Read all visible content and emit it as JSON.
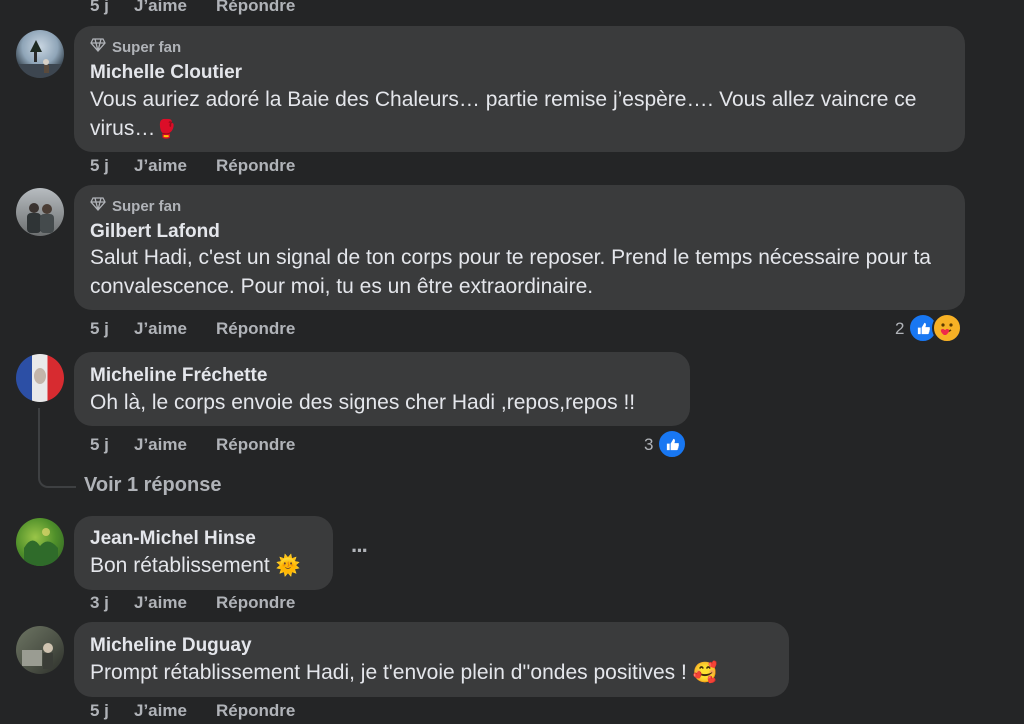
{
  "actions": {
    "like": "J’aime",
    "reply": "Répondre"
  },
  "top_meta": {
    "time": "5 j"
  },
  "comments": [
    {
      "badge": "Super fan",
      "name": "Michelle Cloutier",
      "text": "Vous auriez adoré la Baie des Chaleurs… partie remise j’espère…. Vous allez vaincre ce virus…",
      "emoji": "🥊",
      "time": "5 j"
    },
    {
      "badge": "Super fan",
      "name": "Gilbert Lafond",
      "text": "Salut Hadi, c'est un signal de ton corps pour te reposer. Prend le temps nécessaire pour ta convalescence. Pour moi, tu es un être extraordinaire.",
      "time": "5 j",
      "reaction_count": "2"
    },
    {
      "name": "Micheline Fréchette",
      "text": "Oh là, le corps envoie des signes cher Hadi ,repos,repos !!",
      "time": "5 j",
      "reaction_count": "3"
    },
    {
      "name": "Jean-Michel Hinse",
      "text": "Bon rétablissement",
      "emoji": "🌞",
      "time": "3 j"
    },
    {
      "name": "Micheline Duguay",
      "text": "Prompt rétablissement Hadi, je t'envoie plein d''ondes positives !",
      "emoji": "🥰",
      "time": "5 j"
    }
  ],
  "view_replies": "Voir 1 réponse",
  "more_glyph": "···",
  "colors": {
    "background": "#242526",
    "bubble": "#3a3b3c",
    "like_blue": "#1877f2",
    "care_yellow": "#f7b125"
  }
}
